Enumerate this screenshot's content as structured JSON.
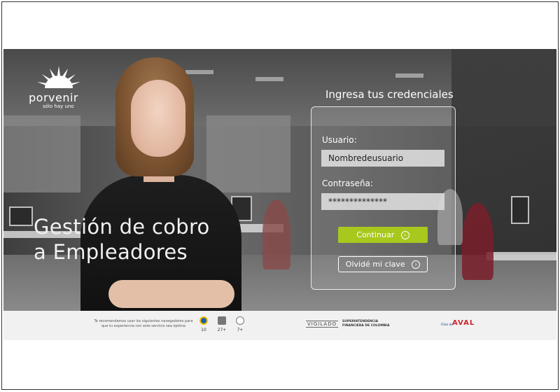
{
  "brand": {
    "name": "porvenir",
    "tagline": "sólo hay uno"
  },
  "hero": {
    "title_line1": "Gestión de cobro",
    "title_line2": "a Empleadores"
  },
  "login": {
    "heading": "Ingresa tus credenciales",
    "username_label": "Usuario:",
    "username_value": "Nombredeusuario",
    "password_label": "Contraseña:",
    "password_value": "**************",
    "continue_label": "Continuar",
    "forgot_label": "Olvidé mi clave"
  },
  "footer": {
    "browser_note": "Te recomendamos usar los siguientes navegadores para que tu experiencia con este servicio sea óptima",
    "browsers": [
      {
        "icon": "internet-explorer-icon",
        "version": "10"
      },
      {
        "icon": "chrome-icon",
        "version": "27+"
      },
      {
        "icon": "safari-icon",
        "version": "7+"
      }
    ],
    "vigilado": "VIGILADO",
    "superintendencia": "SUPERINTENDENCIA FINANCIERA DE COLOMBIA",
    "aval_prefix": "Filial de",
    "aval_name": "AVAL"
  },
  "colors": {
    "accent_green": "#a8c81e",
    "aval_blue": "#1a3a8a",
    "aval_red": "#d0262b"
  }
}
